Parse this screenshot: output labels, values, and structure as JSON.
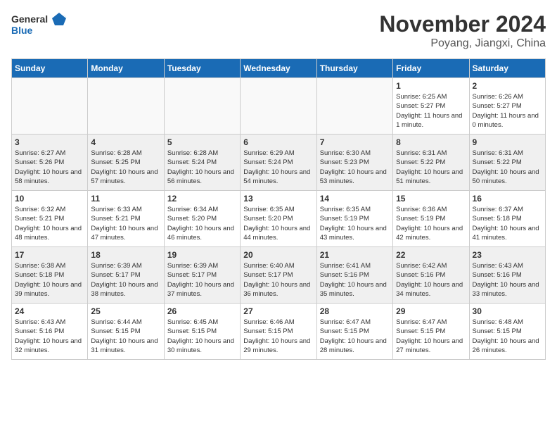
{
  "logo": {
    "line1": "General",
    "line2": "Blue"
  },
  "title": "November 2024",
  "location": "Poyang, Jiangxi, China",
  "days_of_week": [
    "Sunday",
    "Monday",
    "Tuesday",
    "Wednesday",
    "Thursday",
    "Friday",
    "Saturday"
  ],
  "weeks": [
    [
      {
        "day": "",
        "info": ""
      },
      {
        "day": "",
        "info": ""
      },
      {
        "day": "",
        "info": ""
      },
      {
        "day": "",
        "info": ""
      },
      {
        "day": "",
        "info": ""
      },
      {
        "day": "1",
        "info": "Sunrise: 6:25 AM\nSunset: 5:27 PM\nDaylight: 11 hours and 1 minute."
      },
      {
        "day": "2",
        "info": "Sunrise: 6:26 AM\nSunset: 5:27 PM\nDaylight: 11 hours and 0 minutes."
      }
    ],
    [
      {
        "day": "3",
        "info": "Sunrise: 6:27 AM\nSunset: 5:26 PM\nDaylight: 10 hours and 58 minutes."
      },
      {
        "day": "4",
        "info": "Sunrise: 6:28 AM\nSunset: 5:25 PM\nDaylight: 10 hours and 57 minutes."
      },
      {
        "day": "5",
        "info": "Sunrise: 6:28 AM\nSunset: 5:24 PM\nDaylight: 10 hours and 56 minutes."
      },
      {
        "day": "6",
        "info": "Sunrise: 6:29 AM\nSunset: 5:24 PM\nDaylight: 10 hours and 54 minutes."
      },
      {
        "day": "7",
        "info": "Sunrise: 6:30 AM\nSunset: 5:23 PM\nDaylight: 10 hours and 53 minutes."
      },
      {
        "day": "8",
        "info": "Sunrise: 6:31 AM\nSunset: 5:22 PM\nDaylight: 10 hours and 51 minutes."
      },
      {
        "day": "9",
        "info": "Sunrise: 6:31 AM\nSunset: 5:22 PM\nDaylight: 10 hours and 50 minutes."
      }
    ],
    [
      {
        "day": "10",
        "info": "Sunrise: 6:32 AM\nSunset: 5:21 PM\nDaylight: 10 hours and 48 minutes."
      },
      {
        "day": "11",
        "info": "Sunrise: 6:33 AM\nSunset: 5:21 PM\nDaylight: 10 hours and 47 minutes."
      },
      {
        "day": "12",
        "info": "Sunrise: 6:34 AM\nSunset: 5:20 PM\nDaylight: 10 hours and 46 minutes."
      },
      {
        "day": "13",
        "info": "Sunrise: 6:35 AM\nSunset: 5:20 PM\nDaylight: 10 hours and 44 minutes."
      },
      {
        "day": "14",
        "info": "Sunrise: 6:35 AM\nSunset: 5:19 PM\nDaylight: 10 hours and 43 minutes."
      },
      {
        "day": "15",
        "info": "Sunrise: 6:36 AM\nSunset: 5:19 PM\nDaylight: 10 hours and 42 minutes."
      },
      {
        "day": "16",
        "info": "Sunrise: 6:37 AM\nSunset: 5:18 PM\nDaylight: 10 hours and 41 minutes."
      }
    ],
    [
      {
        "day": "17",
        "info": "Sunrise: 6:38 AM\nSunset: 5:18 PM\nDaylight: 10 hours and 39 minutes."
      },
      {
        "day": "18",
        "info": "Sunrise: 6:39 AM\nSunset: 5:17 PM\nDaylight: 10 hours and 38 minutes."
      },
      {
        "day": "19",
        "info": "Sunrise: 6:39 AM\nSunset: 5:17 PM\nDaylight: 10 hours and 37 minutes."
      },
      {
        "day": "20",
        "info": "Sunrise: 6:40 AM\nSunset: 5:17 PM\nDaylight: 10 hours and 36 minutes."
      },
      {
        "day": "21",
        "info": "Sunrise: 6:41 AM\nSunset: 5:16 PM\nDaylight: 10 hours and 35 minutes."
      },
      {
        "day": "22",
        "info": "Sunrise: 6:42 AM\nSunset: 5:16 PM\nDaylight: 10 hours and 34 minutes."
      },
      {
        "day": "23",
        "info": "Sunrise: 6:43 AM\nSunset: 5:16 PM\nDaylight: 10 hours and 33 minutes."
      }
    ],
    [
      {
        "day": "24",
        "info": "Sunrise: 6:43 AM\nSunset: 5:16 PM\nDaylight: 10 hours and 32 minutes."
      },
      {
        "day": "25",
        "info": "Sunrise: 6:44 AM\nSunset: 5:15 PM\nDaylight: 10 hours and 31 minutes."
      },
      {
        "day": "26",
        "info": "Sunrise: 6:45 AM\nSunset: 5:15 PM\nDaylight: 10 hours and 30 minutes."
      },
      {
        "day": "27",
        "info": "Sunrise: 6:46 AM\nSunset: 5:15 PM\nDaylight: 10 hours and 29 minutes."
      },
      {
        "day": "28",
        "info": "Sunrise: 6:47 AM\nSunset: 5:15 PM\nDaylight: 10 hours and 28 minutes."
      },
      {
        "day": "29",
        "info": "Sunrise: 6:47 AM\nSunset: 5:15 PM\nDaylight: 10 hours and 27 minutes."
      },
      {
        "day": "30",
        "info": "Sunrise: 6:48 AM\nSunset: 5:15 PM\nDaylight: 10 hours and 26 minutes."
      }
    ]
  ]
}
